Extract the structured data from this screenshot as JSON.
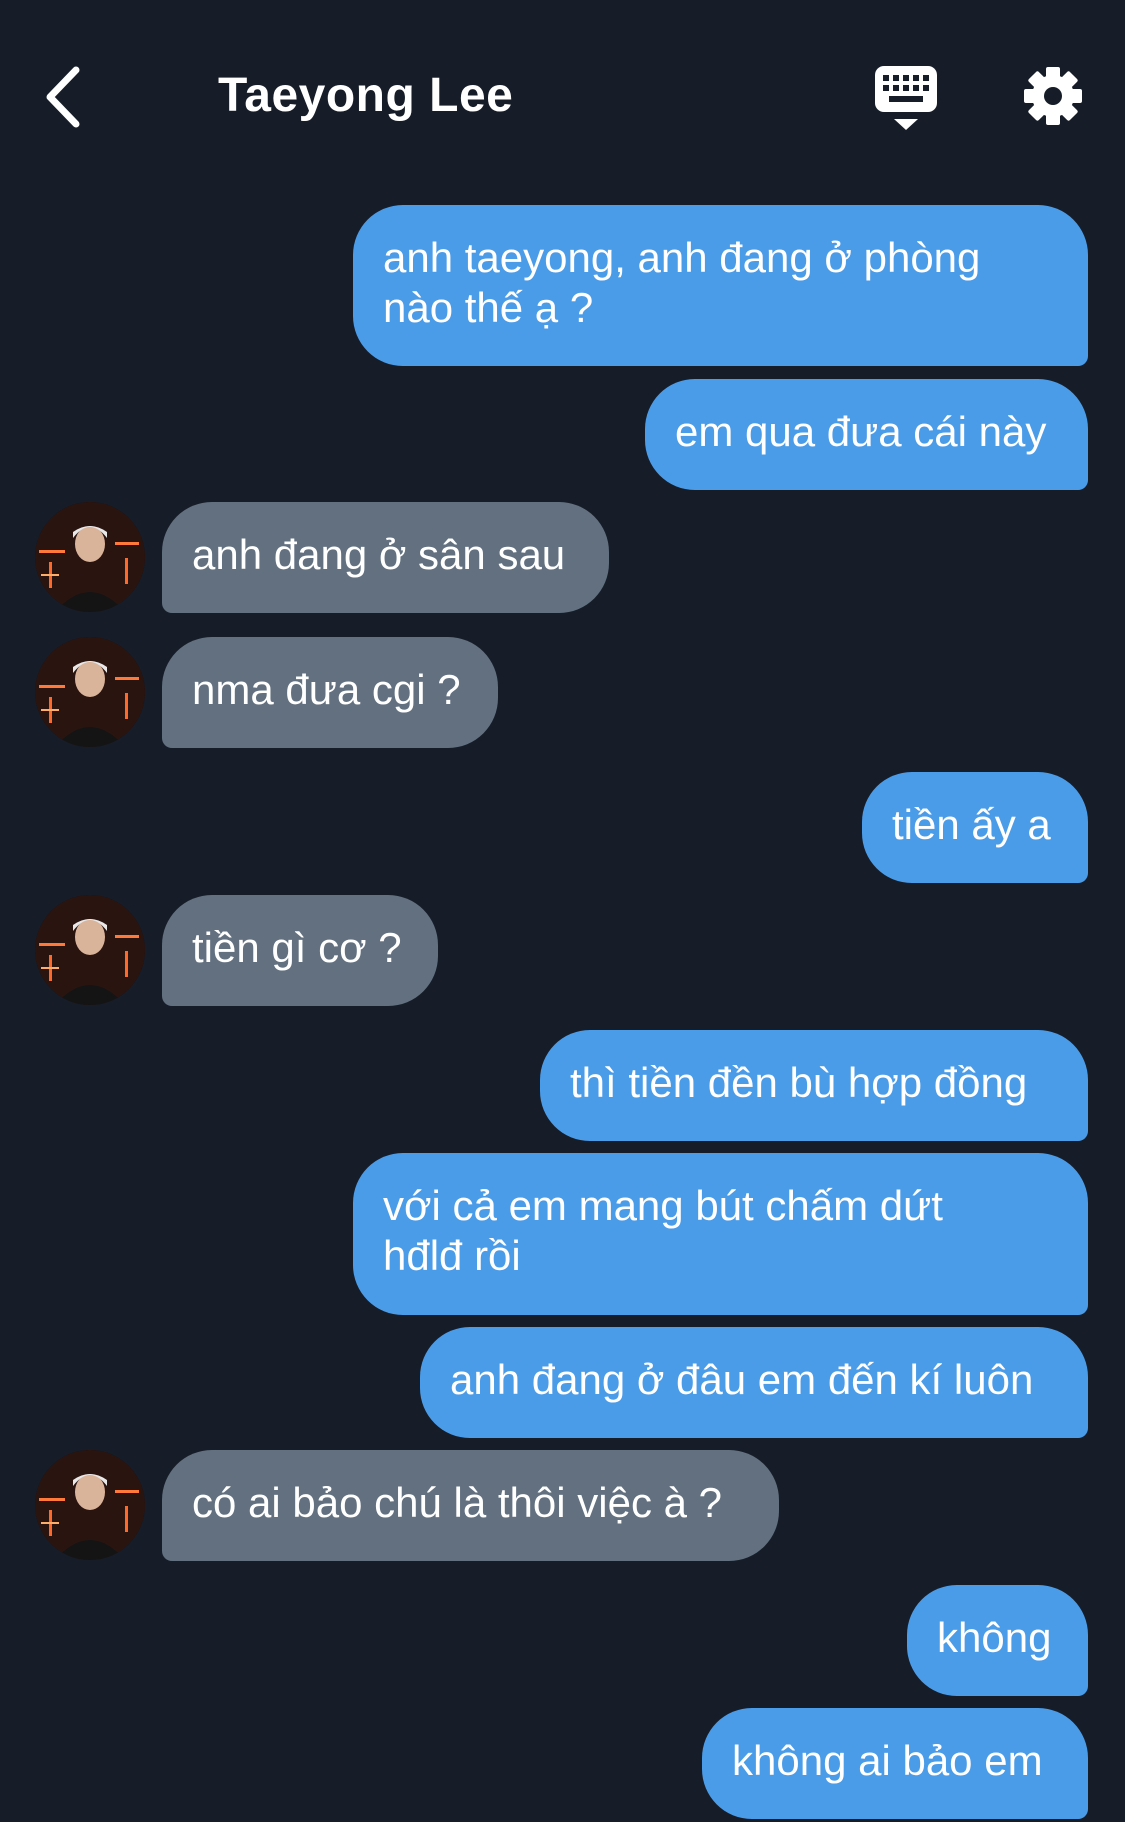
{
  "header": {
    "title": "Taeyong Lee",
    "back_icon": "chevron-left-icon",
    "keyboard_icon": "keyboard-icon",
    "settings_icon": "gear-icon"
  },
  "colors": {
    "background": "#161d28",
    "outgoing_bubble": "#4b9ce8",
    "incoming_bubble": "#627080",
    "text": "#ffffff"
  },
  "messages": [
    {
      "from": "me",
      "text": "anh taeyong, anh đang ở phòng\nnào thế ạ ?"
    },
    {
      "from": "me",
      "text": "em qua đưa cái này"
    },
    {
      "from": "them",
      "text": "anh đang ở sân sau"
    },
    {
      "from": "them",
      "text": "nma đưa cgi ?"
    },
    {
      "from": "me",
      "text": "tiền ấy a"
    },
    {
      "from": "them",
      "text": "tiền gì cơ ?"
    },
    {
      "from": "me",
      "text": "thì tiền đền bù hợp đồng"
    },
    {
      "from": "me",
      "text": "với cả em mang bút chấm dứt\nhđlđ rồi"
    },
    {
      "from": "me",
      "text": "anh đang ở đâu em đến kí luôn"
    },
    {
      "from": "them",
      "text": "có ai bảo chú là thôi việc à ?"
    },
    {
      "from": "me",
      "text": "không"
    },
    {
      "from": "me",
      "text": "không ai bảo em"
    }
  ]
}
